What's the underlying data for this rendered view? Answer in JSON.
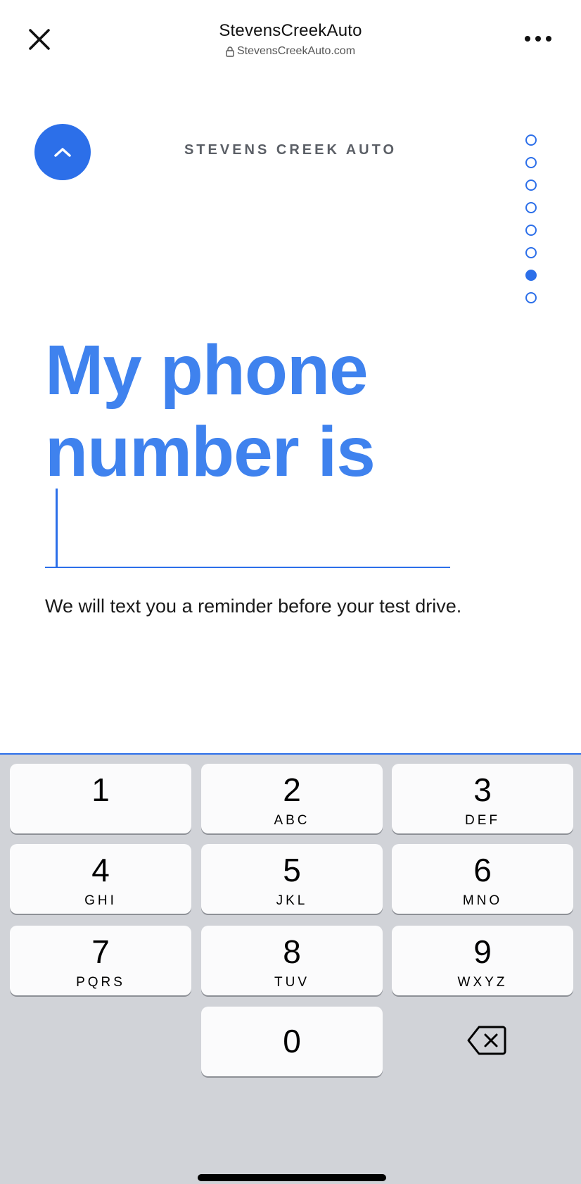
{
  "browser": {
    "title": "StevensCreekAuto",
    "url": "StevensCreekAuto.com",
    "close_icon": "close-icon",
    "more_icon": "more-icon",
    "lock_icon": "lock-icon"
  },
  "page": {
    "brand": "STEVENS CREEK AUTO",
    "up_icon": "chevron-up-icon",
    "progress": {
      "total": 8,
      "current": 7
    },
    "question": "My phone number is",
    "input_value": "",
    "helper": "We will text you a reminder before your test drive."
  },
  "keypad": {
    "keys": [
      {
        "num": "1",
        "letters": ""
      },
      {
        "num": "2",
        "letters": "ABC"
      },
      {
        "num": "3",
        "letters": "DEF"
      },
      {
        "num": "4",
        "letters": "GHI"
      },
      {
        "num": "5",
        "letters": "JKL"
      },
      {
        "num": "6",
        "letters": "MNO"
      },
      {
        "num": "7",
        "letters": "PQRS"
      },
      {
        "num": "8",
        "letters": "TUV"
      },
      {
        "num": "9",
        "letters": "WXYZ"
      },
      {
        "num": "0",
        "letters": ""
      }
    ],
    "backspace_icon": "backspace-icon"
  },
  "colors": {
    "accent": "#2c6fe9",
    "heading": "#3f82ee",
    "keypad_bg": "#d1d3d8",
    "key_bg": "#fbfbfc"
  }
}
